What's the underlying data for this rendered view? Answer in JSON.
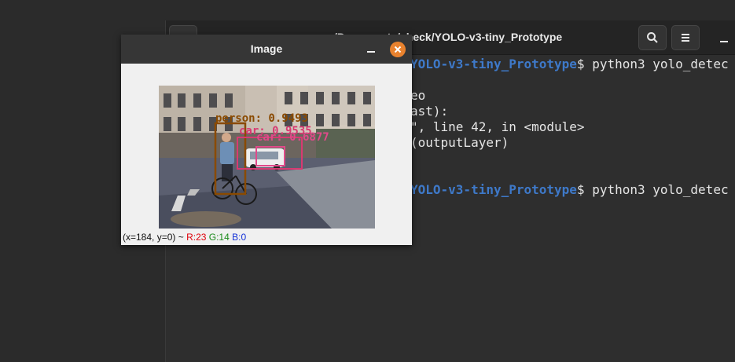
{
  "terminal": {
    "title": "…/Documents/check/YOLO-v3-tiny_Prototype",
    "lines": [
      {
        "path": "YOLO-v3-tiny_Prototype",
        "text": "$ python3 yolo_detec"
      },
      {
        "path": "",
        "text": "eo"
      },
      {
        "path": "",
        "text": "ast):"
      },
      {
        "path": "",
        "text": "\", line 42, in <module>"
      },
      {
        "path": "",
        "text": "(outputLayer)"
      },
      {
        "path": "YOLO-v3-tiny_Prototype",
        "text": "$ python3 yolo_detec"
      }
    ],
    "icons": {
      "search": "search-icon",
      "menu": "hamburger-menu-icon",
      "minimize": "minimize-icon"
    }
  },
  "image_window": {
    "title": "Image",
    "detections": [
      {
        "label": "person: 0.9493",
        "color": "#8a4a00"
      },
      {
        "label": "car: 0.9535",
        "color": "#d83a72"
      },
      {
        "label": "car: 0.6877",
        "color": "#e04a8a"
      }
    ],
    "status": {
      "coords": "(x=184, y=0) ~",
      "r": "R:23",
      "g": "G:14",
      "b": "B:0"
    },
    "icons": {
      "minimize": "minimize-icon",
      "close": "close-icon"
    }
  },
  "colors": {
    "path_blue": "#3e79c9",
    "close_orange": "#e9822e",
    "terminal_bg": "#2e2e2e",
    "desktop_bg": "#2b2b2b"
  }
}
